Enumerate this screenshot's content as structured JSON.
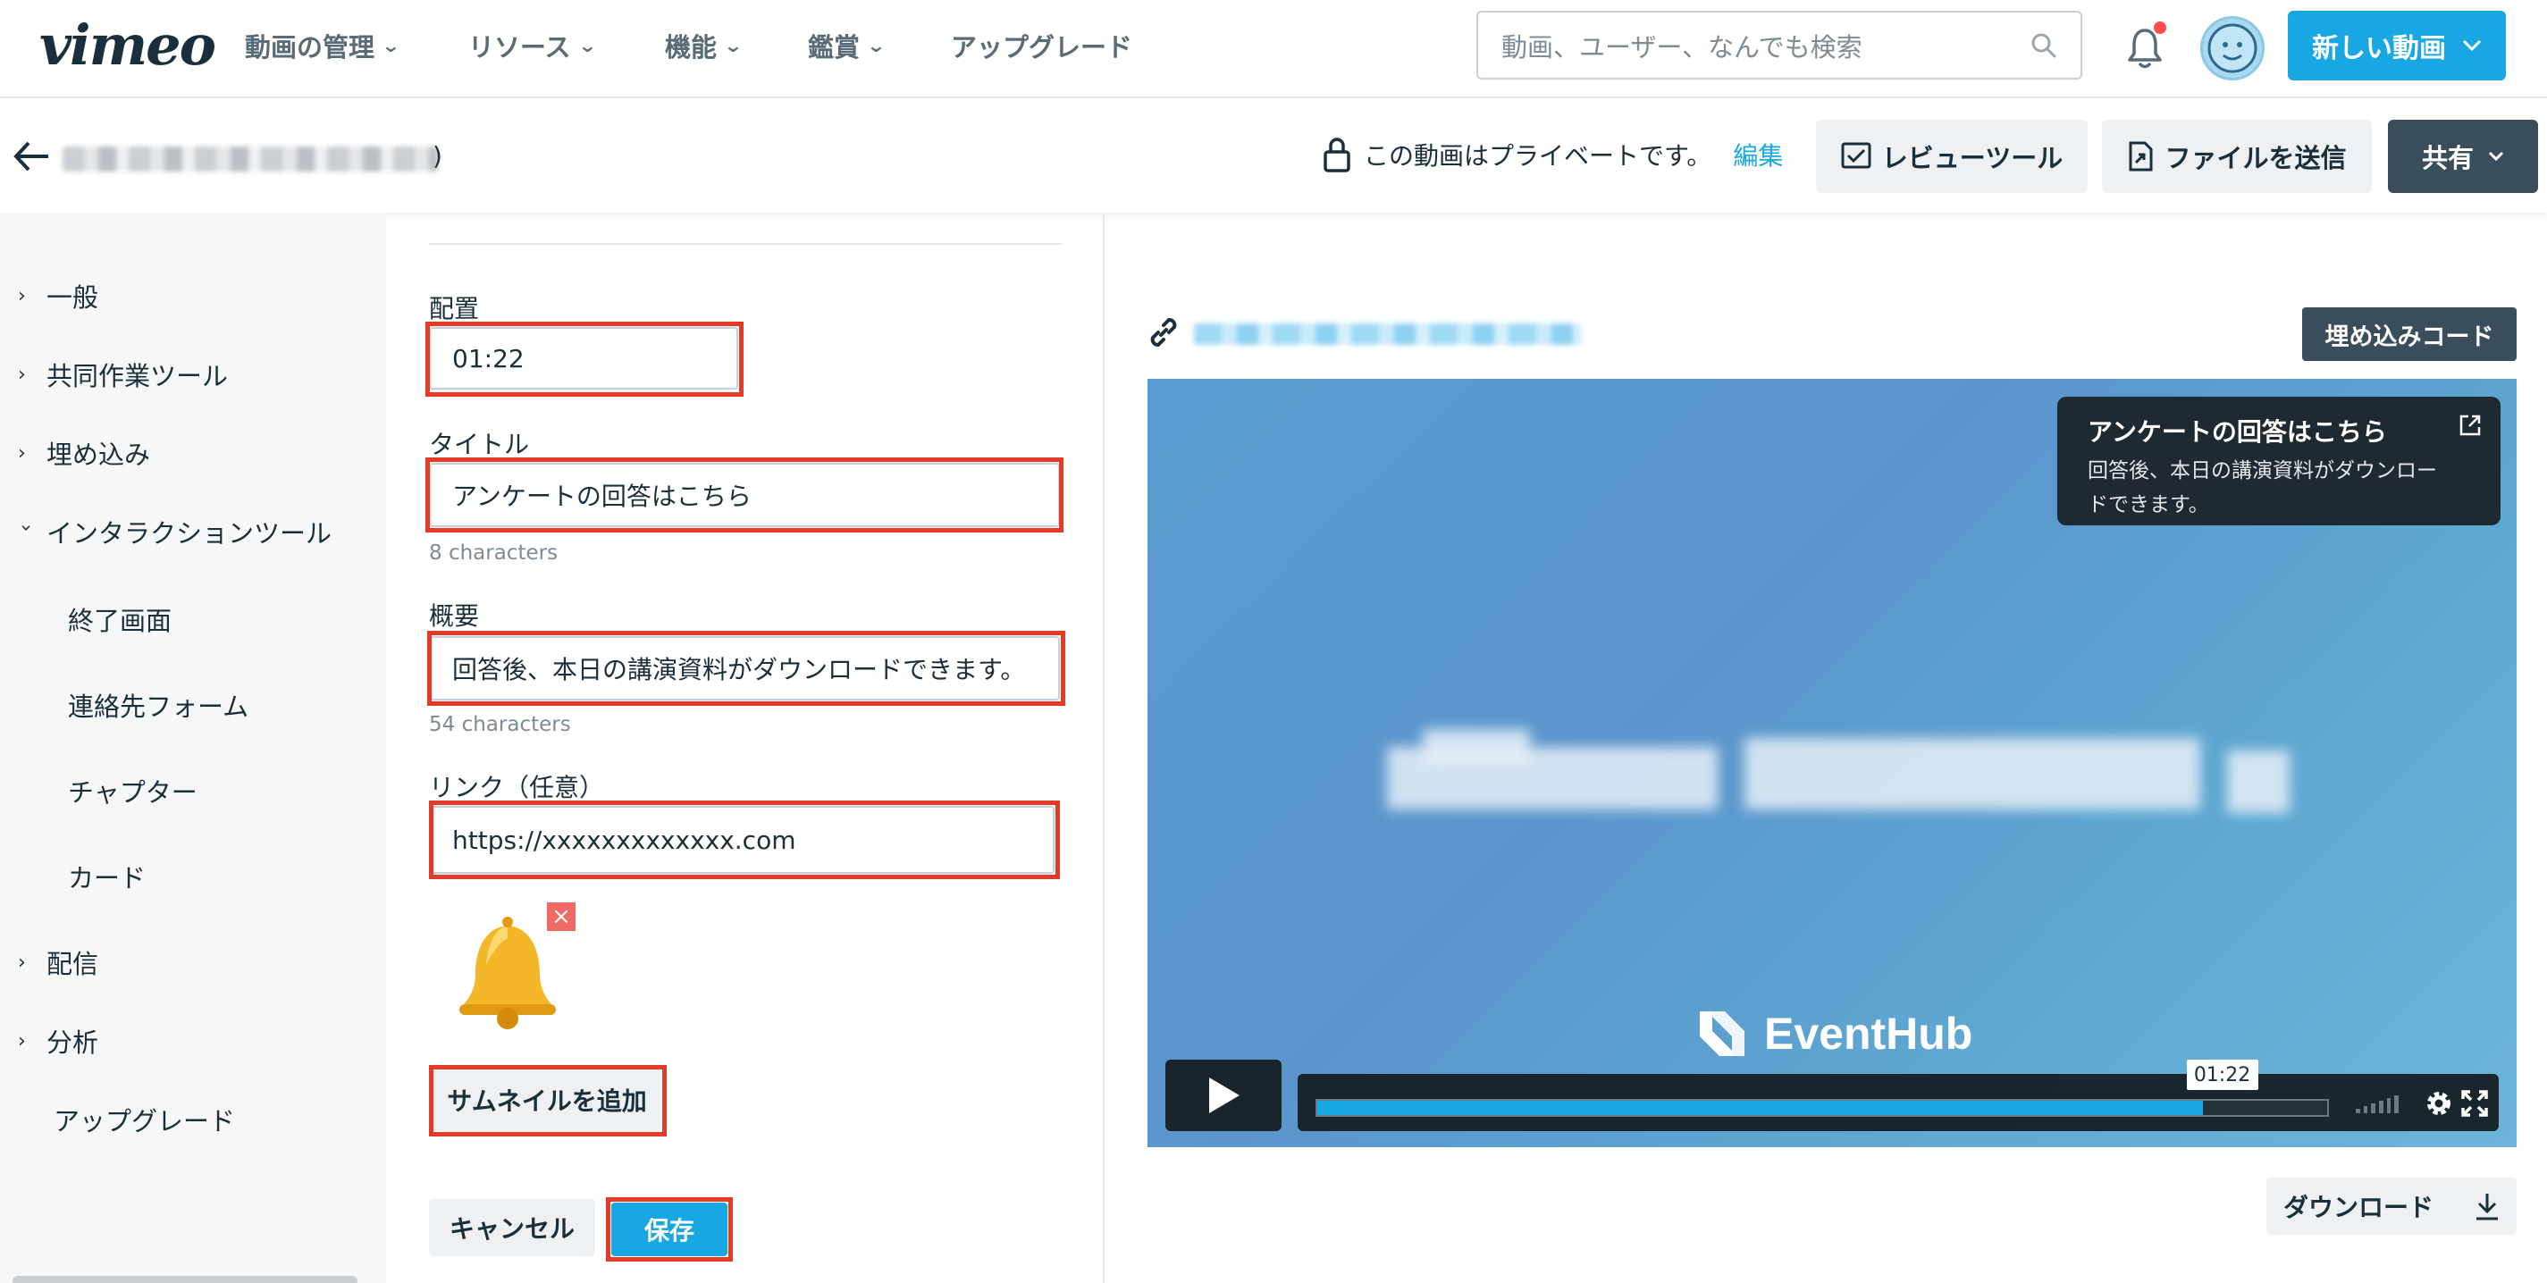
{
  "app": {
    "logo": "vimeo"
  },
  "topnav": {
    "items": [
      {
        "label": "動画の管理"
      },
      {
        "label": "リソース"
      },
      {
        "label": "機能"
      },
      {
        "label": "鑑賞"
      },
      {
        "label": "アップグレード"
      }
    ],
    "search_placeholder": "動画、ユーザー、なんでも検索",
    "new_video_label": "新しい動画"
  },
  "subheader": {
    "title_suffix": ")",
    "privacy_text": "この動画はプライベートです。",
    "edit_label": "編集",
    "review_tool_label": "レビューツール",
    "send_file_label": "ファイルを送信",
    "share_label": "共有"
  },
  "sidebar": {
    "items": [
      {
        "label": "一般"
      },
      {
        "label": "共同作業ツール"
      },
      {
        "label": "埋め込み"
      },
      {
        "label": "インタラクションツール"
      },
      {
        "label": "終了画面"
      },
      {
        "label": "連絡先フォーム"
      },
      {
        "label": "チャプター"
      },
      {
        "label": "カード"
      },
      {
        "label": "配信"
      },
      {
        "label": "分析"
      },
      {
        "label": "アップグレード"
      }
    ]
  },
  "form": {
    "position_label": "配置",
    "position_value": "01:22",
    "title_label": "タイトル",
    "title_value": "アンケートの回答はこちら",
    "title_count": "8 characters",
    "summary_label": "概要",
    "summary_value": "回答後、本日の講演資料がダウンロードできます。",
    "summary_count": "54 characters",
    "link_label": "リンク（任意）",
    "link_value": "https://xxxxxxxxxxxxx.com",
    "add_thumbnail_label": "サムネイルを追加",
    "cancel_label": "キャンセル",
    "save_label": "保存"
  },
  "preview": {
    "embed_code_label": "埋め込みコード",
    "card_title": "アンケートの回答はこちら",
    "card_description": "回答後、本日の講演資料がダウンロードできます。",
    "brand_text": "EventHub",
    "current_time": "01:22",
    "progress": 0.877,
    "download_label": "ダウンロード"
  },
  "colors": {
    "accent": "#17a8e3",
    "highlight": "#e33b28",
    "dark": "#394d5b"
  },
  "icons": {
    "search": "search-icon",
    "bell": "bell-icon",
    "lock": "lock-icon",
    "link": "link-icon",
    "play": "play-icon",
    "settings": "gear-icon",
    "fullscreen": "fullscreen-icon",
    "download": "download-icon"
  }
}
